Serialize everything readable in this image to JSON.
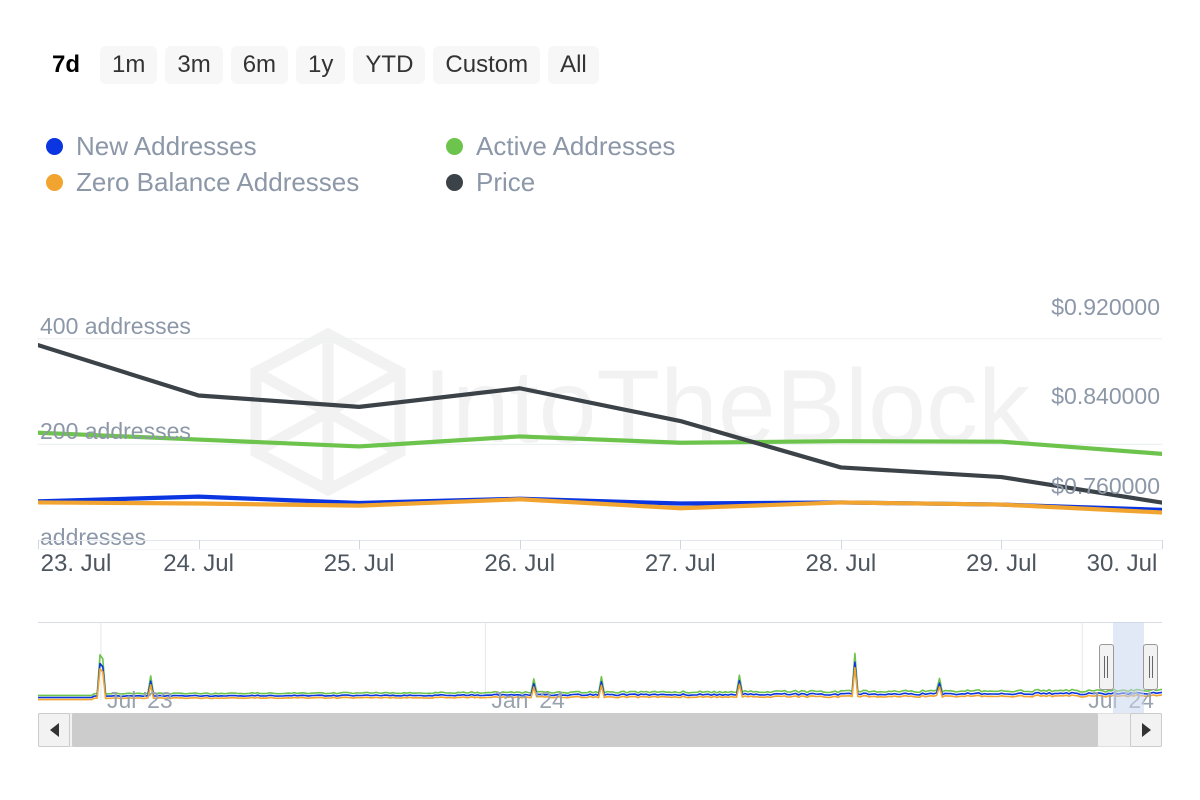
{
  "range_selector": {
    "buttons": [
      {
        "label": "7d",
        "selected": true
      },
      {
        "label": "1m",
        "selected": false
      },
      {
        "label": "3m",
        "selected": false
      },
      {
        "label": "6m",
        "selected": false
      },
      {
        "label": "1y",
        "selected": false
      },
      {
        "label": "YTD",
        "selected": false
      },
      {
        "label": "Custom",
        "selected": false
      },
      {
        "label": "All",
        "selected": false
      }
    ]
  },
  "legend": {
    "items": [
      {
        "label": "New Addresses",
        "color": "#0a35e0",
        "icon": "legend-dot-icon"
      },
      {
        "label": "Active Addresses",
        "color": "#6dc44c",
        "icon": "legend-dot-icon"
      },
      {
        "label": "Zero Balance Addresses",
        "color": "#f2a430",
        "icon": "legend-dot-icon"
      },
      {
        "label": "Price",
        "color": "#3b4248",
        "icon": "legend-dot-icon"
      }
    ]
  },
  "watermark": {
    "text": "IntoTheBlock",
    "color": "#f2f2f2"
  },
  "navigator": {
    "xlabels": [
      {
        "text": "Jul '23",
        "x_pct": 5.6
      },
      {
        "text": "Jan '24",
        "x_pct": 39.8
      },
      {
        "text": "Jul '24",
        "x_pct": 92.9
      }
    ],
    "selection": {
      "start_pct": 95.6,
      "end_pct": 98.4
    },
    "handle_icon": "grip-handle-icon"
  },
  "scrollbar": {
    "left_button_icon": "arrow-left-icon",
    "right_button_icon": "arrow-right-icon",
    "thumb": {
      "start_pct": 0.0,
      "end_pct": 97.2
    }
  },
  "chart_data": {
    "type": "line",
    "title": "",
    "xlabel": "",
    "x": [
      "23. Jul",
      "24. Jul",
      "25. Jul",
      "26. Jul",
      "27. Jul",
      "28. Jul",
      "29. Jul",
      "30. Jul"
    ],
    "left_axis": {
      "label": "addresses",
      "ticks": [
        "addresses",
        "200 addresses",
        "400 addresses"
      ],
      "tick_values": [
        0,
        200,
        400
      ],
      "ylim": [
        0,
        530
      ]
    },
    "right_axis": {
      "label": "Price",
      "ticks": [
        "$0.760000",
        "$0.840000",
        "$0.920000"
      ],
      "tick_values": [
        0.76,
        0.84,
        0.92
      ],
      "ylim": [
        0.714,
        0.965
      ]
    },
    "grid": true,
    "legend_position": "top-left",
    "series": [
      {
        "name": "New Addresses",
        "color": "#0a35e0",
        "axis": "left",
        "unit": "addresses",
        "values": [
          92,
          101,
          89,
          97,
          88,
          90,
          86,
          76
        ]
      },
      {
        "name": "Active Addresses",
        "color": "#6dc44c",
        "axis": "left",
        "unit": "addresses",
        "values": [
          222,
          209,
          196,
          215,
          203,
          206,
          205,
          182
        ]
      },
      {
        "name": "Zero Balance Addresses",
        "color": "#f2a430",
        "axis": "left",
        "unit": "addresses",
        "values": [
          90,
          88,
          84,
          96,
          79,
          90,
          86,
          71
        ]
      },
      {
        "name": "Price",
        "color": "#3b4248",
        "axis": "right",
        "unit": "USD",
        "values": [
          0.8977,
          0.8525,
          0.8423,
          0.859,
          0.8296,
          0.788,
          0.7794,
          0.7565
        ]
      }
    ]
  }
}
